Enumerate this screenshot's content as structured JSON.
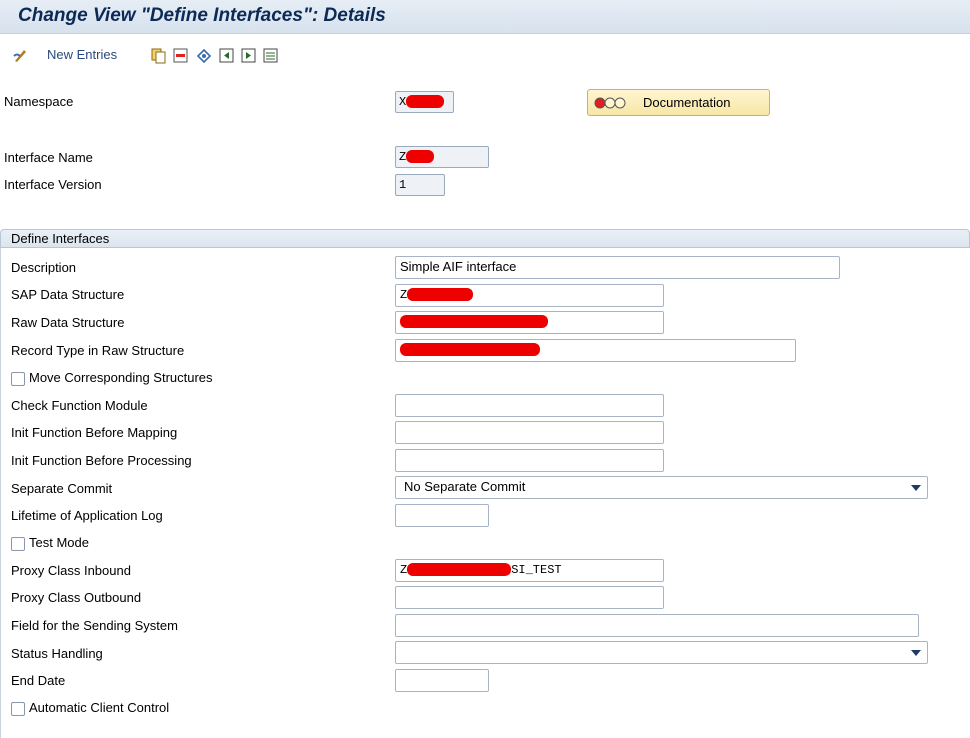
{
  "window": {
    "title": "Change View \"Define Interfaces\": Details"
  },
  "toolbar": {
    "new_entries_label": "New Entries",
    "icons": [
      "edit-icon",
      "copy-icon",
      "delete-icon",
      "undo-icon",
      "previous-entry-icon",
      "next-entry-icon",
      "variable-list-icon"
    ]
  },
  "header": {
    "namespace_label": "Namespace",
    "namespace_value": "X",
    "documentation_label": "Documentation",
    "interface_name_label": "Interface Name",
    "interface_name_value": "Z",
    "interface_version_label": "Interface Version",
    "interface_version_value": "1"
  },
  "group": {
    "title": "Define Interfaces",
    "description_label": "Description",
    "description_value": "Simple AIF interface",
    "sap_structure_label": "SAP Data Structure",
    "sap_structure_value": "Z",
    "raw_structure_label": "Raw Data Structure",
    "record_type_label": "Record Type in Raw Structure",
    "move_corresponding_label": "Move Corresponding Structures",
    "move_corresponding_checked": false,
    "check_fm_label": "Check Function Module",
    "init_mapping_label": "Init Function Before Mapping",
    "init_processing_label": "Init Function Before Processing",
    "separate_commit_label": "Separate Commit",
    "separate_commit_value": "No Separate Commit",
    "lifetime_label": "Lifetime of Application Log",
    "test_mode_label": "Test Mode",
    "test_mode_checked": false,
    "proxy_inbound_label": "Proxy Class Inbound",
    "proxy_inbound_prefix": "Z",
    "proxy_inbound_suffix": "SI_TEST",
    "proxy_outbound_label": "Proxy Class Outbound",
    "sending_system_label": "Field for the Sending System",
    "status_handling_label": "Status Handling",
    "status_handling_value": "",
    "end_date_label": "End Date",
    "auto_client_label": "Automatic Client Control",
    "auto_client_checked": false
  },
  "colors": {
    "title": "#0b2a55",
    "redaction": "#ee0000",
    "doc_button": "#f7e6a6"
  }
}
